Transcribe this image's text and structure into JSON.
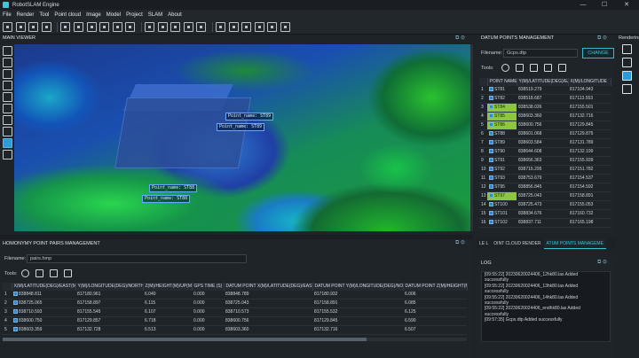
{
  "app": {
    "title": "RobotSLAM Engine",
    "window_controls": [
      "—",
      "☐",
      "✕"
    ]
  },
  "menu": [
    "File",
    "Render",
    "Tool",
    "Point cloud",
    "Image",
    "Model",
    "Project",
    "SLAM",
    "About"
  ],
  "toolbar_icons": [
    "new-project-icon",
    "open-icon",
    "save-icon",
    "save-as-icon",
    "import-icon",
    "export-icon",
    "layer-icon",
    "crop-icon",
    "measure-icon",
    "filter-icon",
    "undo-icon",
    "redo-icon",
    "rotate-icon",
    "scale-icon",
    "transform-icon",
    "snapshot-icon",
    "image-icon",
    "photo-icon",
    "camera-icon",
    "settings-icon",
    "model-icon"
  ],
  "main_viewer": {
    "title": "MAIN VIEWER",
    "labels": [
      {
        "text": "Point_name: ST89",
        "name": "point-label-st89-a"
      },
      {
        "text": "Point_name: ST89",
        "name": "point-label-st89-b"
      },
      {
        "text": "Point_name: ST88",
        "name": "point-label-st88-a"
      },
      {
        "text": "Point_name: ST88",
        "name": "point-label-st88-b"
      }
    ]
  },
  "datum_panel": {
    "title": "DATUM POINTS MANAGEMENT",
    "filename_label": "Filename:",
    "filename_value": "Gcps.dtp",
    "change_label": "CHANGE",
    "tools_label": "Tools:",
    "columns": [
      "POINT NAME",
      "Y(M)/LATITUDE(DEG)/EAST(M)",
      "X(M)/LONGITUDE"
    ],
    "rows": [
      {
        "n": "1",
        "name": "ST81",
        "y": "838519.279",
        "x": "817104.943",
        "hl": false
      },
      {
        "n": "2",
        "name": "ST82",
        "y": "838518.687",
        "x": "817113.553",
        "hl": false
      },
      {
        "n": "3",
        "name": "ST84",
        "y": "838538.026",
        "x": "817155.501",
        "hl": true
      },
      {
        "n": "4",
        "name": "ST85",
        "y": "838603.360",
        "x": "817132.716",
        "hl": true
      },
      {
        "n": "5",
        "name": "ST86",
        "y": "838600.756",
        "x": "817129.845",
        "hl": true
      },
      {
        "n": "6",
        "name": "ST88",
        "y": "838601.068",
        "x": "817129.875",
        "hl": false
      },
      {
        "n": "7",
        "name": "ST89",
        "y": "838603.584",
        "x": "817131.789",
        "hl": false
      },
      {
        "n": "8",
        "name": "ST90",
        "y": "838644.608",
        "x": "817132.199",
        "hl": false
      },
      {
        "n": "9",
        "name": "ST91",
        "y": "838656.363",
        "x": "817155.939",
        "hl": false
      },
      {
        "n": "10",
        "name": "ST92",
        "y": "838716.295",
        "x": "817151.782",
        "hl": false
      },
      {
        "n": "11",
        "name": "ST93",
        "y": "838753.679",
        "x": "817154.537",
        "hl": false
      },
      {
        "n": "12",
        "name": "ST95",
        "y": "838856.845",
        "x": "817154.592",
        "hl": false
      },
      {
        "n": "13",
        "name": "ST97",
        "y": "838725.043",
        "x": "817158.891",
        "hl": true
      },
      {
        "n": "14",
        "name": "ST100",
        "y": "838725.473",
        "x": "817155.053",
        "hl": false
      },
      {
        "n": "15",
        "name": "ST101",
        "y": "838834.676",
        "x": "817160.732",
        "hl": false
      },
      {
        "n": "16",
        "name": "ST102",
        "y": "838837.711",
        "x": "817165.198",
        "hl": false
      }
    ]
  },
  "right_toolbar": {
    "label": "Rendering"
  },
  "homonymy_panel": {
    "title": "HOMONYMY POINT PAIRS MANAGEMENT",
    "filename_label": "Filename:",
    "filename_value": "pairs.hmp",
    "tools_label": "Tools:",
    "columns": [
      "X(M)/LATITUDE(DEG)/EAST(M)",
      "Y(M)/LONGITUDE(DEG)/NORTH(M)",
      "Z(M)/HEIGHT(M)/UP(M)",
      "GPS TIME (S)",
      "DATUM POINT X(M)/LATITUDE(DEG)/EAST(M)",
      "DATUM POINT Y(M)/LONGITUDE(DEG)/NORTH(M)",
      "DATUM POINT Z(M)/HEIGHT(M)/UP(M)"
    ],
    "rows": [
      {
        "n": "1",
        "c": [
          "838848.811",
          "817180.961",
          "6.040",
          "0.000",
          "838848.789",
          "817180.932",
          "6.006"
        ]
      },
      {
        "n": "2",
        "c": [
          "838725.065",
          "817158.897",
          "6.115",
          "0.000",
          "838725.043",
          "817158.891",
          "6.085"
        ]
      },
      {
        "n": "3",
        "c": [
          "838710.593",
          "817155.545",
          "6.107",
          "0.000",
          "838710.573",
          "817155.532",
          "6.125"
        ]
      },
      {
        "n": "4",
        "c": [
          "838600.750",
          "817129.857",
          "6.718",
          "0.000",
          "838600.756",
          "817129.845",
          "6.590"
        ]
      },
      {
        "n": "5",
        "c": [
          "838603.359",
          "817132.728",
          "6.513",
          "0.000",
          "838603.360",
          "817132.716",
          "6.507"
        ]
      }
    ]
  },
  "tabs": [
    "LE L",
    "OINT CLOUD RENDER",
    "ATUM POINTS MANAGEME"
  ],
  "log": {
    "title": "LOG",
    "lines": [
      "[09:55:22] 20230620024406_12hk80.las Added",
      "successfully",
      "[09:55:22] 20230620024406_13hk80.las Added",
      "successfully",
      "[09:55:22] 20230620024406_14hk80.las Added",
      "successfully",
      "[09:55:22] 20230620024406_endhk80.las Added",
      "successfully",
      "[09:57:35] Gcps.dtp Added successfully"
    ]
  },
  "colors": {
    "accent": "#36c6d8",
    "highlight": "#8cc63e",
    "bg": "#1e2328"
  }
}
